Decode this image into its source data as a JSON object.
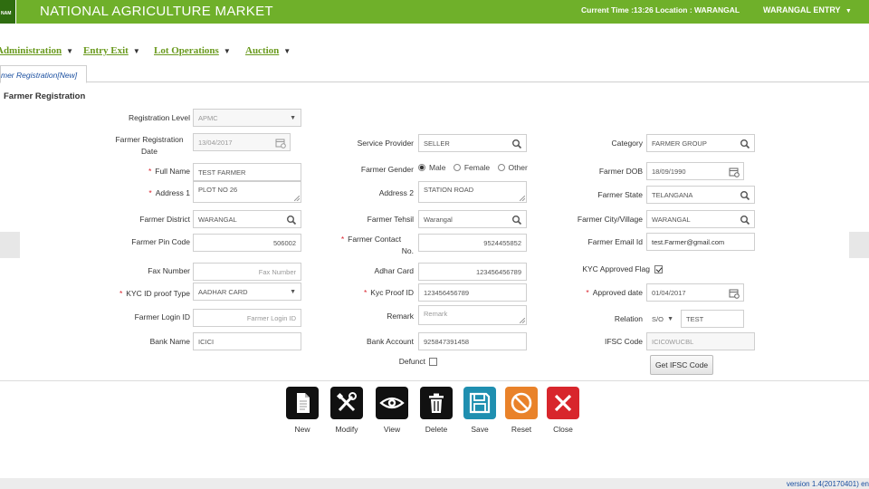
{
  "header": {
    "logo_text": "NAM",
    "title": "NATIONAL AGRICULTURE MARKET",
    "info": "Current Time :13:26  Location : WARANGAL",
    "entry": "WARANGAL ENTRY",
    "entry_caret": "▼",
    "colors": {
      "bar": "#6fb02a",
      "menu_text": "#6a9a1e",
      "required": "#d9212c",
      "link": "#1a4fa0"
    }
  },
  "menu": [
    {
      "label": "Administration"
    },
    {
      "label": "Entry Exit"
    },
    {
      "label": "Lot Operations"
    },
    {
      "label": "Auction"
    }
  ],
  "menu_caret": "▼",
  "tab": {
    "label": "mer Registration[New]"
  },
  "section_title": "Farmer Registration",
  "labels": {
    "registration_level": "Registration Level",
    "registration_date_1": "Farmer Registration",
    "registration_date_2": "Date",
    "full_name": "Full Name",
    "address1": "Address 1",
    "district": "Farmer District",
    "pin_code": "Farmer Pin Code",
    "fax": "Fax Number",
    "kyc_type": "KYC ID proof Type",
    "login_id": "Farmer Login ID",
    "bank_name": "Bank Name",
    "service_provider": "Service Provider",
    "gender": "Farmer Gender",
    "address2": "Address 2",
    "tehsil": "Farmer Tehsil",
    "contact_1": "Farmer Contact",
    "contact_2": "No.",
    "adhar": "Adhar Card",
    "kyc_proof": "Kyc Proof ID",
    "remark": "Remark",
    "bank_account": "Bank Account",
    "defunct": "Defunct",
    "category": "Category",
    "dob": "Farmer DOB",
    "state": "Farmer State",
    "city": "Farmer City/Village",
    "email": "Farmer Email Id",
    "kyc_flag": "KYC Approved Flag",
    "approved_date": "Approved date",
    "relation": "Relation",
    "ifsc": "IFSC Code",
    "required_mark": "*"
  },
  "values": {
    "registration_level": "APMC",
    "registration_date": "13/04/2017",
    "full_name": "TEST FARMER",
    "address1": "PLOT NO 26",
    "district": "WARANGAL",
    "pin_code": "506002",
    "fax_placeholder": "Fax Number",
    "kyc_type": "AADHAR CARD",
    "login_id_placeholder": "Farmer Login ID",
    "bank_name": "ICICI",
    "service_provider": "SELLER",
    "address2": "STATION ROAD",
    "tehsil": "Warangal",
    "contact": "9524455852",
    "adhar": "123456456789",
    "kyc_proof": "123456456789",
    "remark_placeholder": "Remark",
    "bank_account": "925847391458",
    "category": "FARMER GROUP",
    "dob": "18/09/1990",
    "state": "TELANGANA",
    "city": "WARANGAL",
    "email": "test.Farmer@gmail.com",
    "approved_date": "01/04/2017",
    "relation_type": "S/O",
    "relation_name": "TEST",
    "ifsc": "ICIC0WUCBL",
    "gender_options": [
      "Male",
      "Female",
      "Other"
    ],
    "gender_selected": "Male",
    "kyc_flag_checked": true,
    "defunct_checked": false
  },
  "buttons": {
    "get_ifsc": "Get IFSC Code",
    "actions": [
      {
        "label": "New",
        "icon": "document-icon",
        "color": "#111111"
      },
      {
        "label": "Modify",
        "icon": "tools-icon",
        "color": "#111111"
      },
      {
        "label": "View",
        "icon": "eye-icon",
        "color": "#111111"
      },
      {
        "label": "Delete",
        "icon": "trash-icon",
        "color": "#111111"
      },
      {
        "label": "Save",
        "icon": "floppy-icon",
        "color": "#1f8fb0"
      },
      {
        "label": "Reset",
        "icon": "reset-icon",
        "color": "#e9822a"
      },
      {
        "label": "Close",
        "icon": "close-icon",
        "color": "#d8262c"
      }
    ]
  },
  "footer": {
    "version": "version 1.4(20170401)  en"
  }
}
